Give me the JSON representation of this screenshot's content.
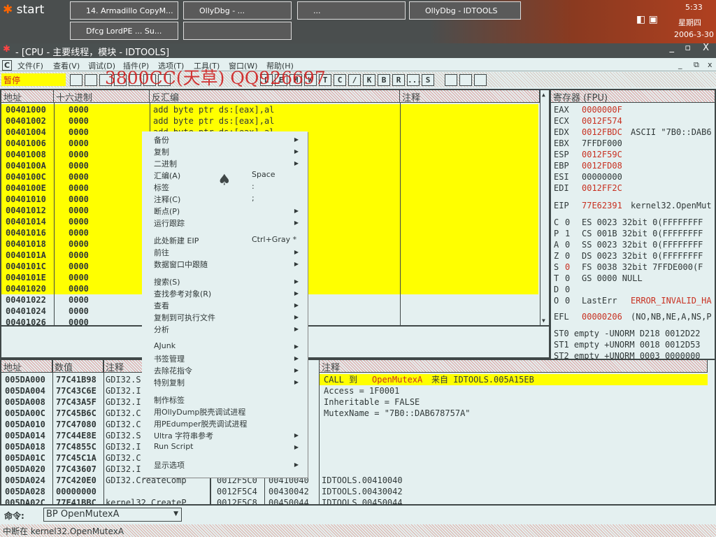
{
  "taskbar": {
    "start": "start",
    "tasks": [
      "14. Armadillo CopyM...",
      "OllyDbg - ...",
      "...",
      "OllyDbg - IDTOOLS",
      "Dfcg LordPE ... Su...",
      ""
    ],
    "time": "5:33",
    "weekday": "星期四",
    "date": "2006-3-30"
  },
  "window": {
    "title": "- [CPU - 主要线程，模块 - IDTOOLS]"
  },
  "menu": [
    "文件(F)",
    "查看(V)",
    "调试(D)",
    "插件(P)",
    "选项(T)",
    "工具(T)",
    "窗口(W)",
    "帮助(H)"
  ],
  "toolbar": {
    "status": "暂停",
    "letters": [
      "L",
      "E",
      "M",
      "W",
      "T",
      "C",
      "/",
      "K",
      "B",
      "R",
      "...",
      "S"
    ],
    "watermark": "3800CC(天草)  QQ926697"
  },
  "disasm": {
    "headers": [
      "地址",
      "十六进制",
      "反汇编",
      "注释"
    ],
    "rows": [
      [
        "00401000",
        "0000",
        "add byte ptr ds:[eax],al"
      ],
      [
        "00401002",
        "0000",
        "add byte ptr ds:[eax],al"
      ],
      [
        "00401004",
        "0000",
        "add byte ptr ds:[eax],al"
      ],
      [
        "00401006",
        "0000",
        ""
      ],
      [
        "00401008",
        "0000",
        ""
      ],
      [
        "0040100A",
        "0000",
        ""
      ],
      [
        "0040100C",
        "0000",
        ""
      ],
      [
        "0040100E",
        "0000",
        ""
      ],
      [
        "00401010",
        "0000",
        ""
      ],
      [
        "00401012",
        "0000",
        ""
      ],
      [
        "00401014",
        "0000",
        ""
      ],
      [
        "00401016",
        "0000",
        ""
      ],
      [
        "00401018",
        "0000",
        ""
      ],
      [
        "0040101A",
        "0000",
        ""
      ],
      [
        "0040101C",
        "0000",
        ""
      ],
      [
        "0040101E",
        "0000",
        ""
      ],
      [
        "00401020",
        "0000",
        ""
      ],
      [
        "00401022",
        "0000",
        ""
      ],
      [
        "00401024",
        "0000",
        ""
      ],
      [
        "00401026",
        "0000",
        ""
      ]
    ],
    "highlighted_count": 17
  },
  "registers": {
    "header": "寄存器 (FPU)",
    "gp": [
      [
        "EAX",
        "0000000F",
        true,
        ""
      ],
      [
        "ECX",
        "0012F574",
        true,
        ""
      ],
      [
        "EDX",
        "0012FBDC",
        true,
        "ASCII \"7B0::DAB6"
      ],
      [
        "EBX",
        "7FFDF000",
        false,
        ""
      ],
      [
        "ESP",
        "0012F59C",
        true,
        ""
      ],
      [
        "EBP",
        "0012FD08",
        true,
        ""
      ],
      [
        "ESI",
        "00000000",
        false,
        ""
      ],
      [
        "EDI",
        "0012FF2C",
        true,
        ""
      ]
    ],
    "eip": [
      "EIP",
      "77E62391",
      "kernel32.OpenMut"
    ],
    "flags": [
      [
        "C",
        "0",
        "ES 0023 32bit 0(FFFFFFFF"
      ],
      [
        "P",
        "1",
        "CS 001B 32bit 0(FFFFFFFF"
      ],
      [
        "A",
        "0",
        "SS 0023 32bit 0(FFFFFFFF"
      ],
      [
        "Z",
        "0",
        "DS 0023 32bit 0(FFFFFFFF"
      ],
      [
        "S",
        "0",
        "FS 0038 32bit 7FFDE000(F"
      ],
      [
        "T",
        "0",
        "GS 0000 NULL"
      ],
      [
        "D",
        "0",
        ""
      ],
      [
        "O",
        "0",
        "LastErr"
      ]
    ],
    "lasterr": "ERROR_INVALID_HA",
    "efl": [
      "EFL",
      "00000206",
      "(NO,NB,NE,A,NS,P"
    ],
    "fpu": [
      "ST0 empty -UNORM D218 0012D22",
      "ST1 empty +UNORM 0018 0012D53",
      "ST2 empty +UNORM 0003 0000000"
    ]
  },
  "dump": {
    "headers": [
      "地址",
      "数值",
      "注释"
    ],
    "rows": [
      [
        "005DA000",
        "77C41B98",
        "GDI32.S"
      ],
      [
        "005DA004",
        "77C43C6E",
        "GDI32.I"
      ],
      [
        "005DA008",
        "77C43A5F",
        "GDI32.I"
      ],
      [
        "005DA00C",
        "77C45B6C",
        "GDI32.C"
      ],
      [
        "005DA010",
        "77C47080",
        "GDI32.C"
      ],
      [
        "005DA014",
        "77C44E8E",
        "GDI32.S"
      ],
      [
        "005DA018",
        "77C4855C",
        "GDI32.I"
      ],
      [
        "005DA01C",
        "77C45C1A",
        "GDI32.C"
      ],
      [
        "005DA020",
        "77C43607",
        "GDI32.I"
      ],
      [
        "005DA024",
        "77C420E0",
        "GDI32.CreateComp"
      ],
      [
        "005DA028",
        "00000000",
        ""
      ],
      [
        "005DA02C",
        "77E41BBC",
        "kernel32.CreateP"
      ]
    ]
  },
  "stack": {
    "header": "注释",
    "call": {
      "prefix": "CALL 到",
      "func": "OpenMutexA",
      "from": "来自 IDTOOLS.005A15EB"
    },
    "args": [
      "Access = 1F0001",
      "Inheritable = FALSE",
      "MutexName = \"7B0::DAB678757A\""
    ],
    "rows": [
      [
        "0012F5C0",
        "00410040",
        "IDTOOLS.00410040"
      ],
      [
        "0012F5C4",
        "00430042",
        "IDTOOLS.00430042"
      ],
      [
        "0012F5C8",
        "00450044",
        "IDTOOLS.00450044"
      ]
    ]
  },
  "context_menu": [
    {
      "label": "备份",
      "sub": true
    },
    {
      "label": "复制",
      "sub": true
    },
    {
      "label": "二进制",
      "sub": true
    },
    {
      "label": "汇编(A)",
      "shortcut": "Space"
    },
    {
      "label": "标签",
      "shortcut": ":"
    },
    {
      "label": "注释(C)",
      "shortcut": ";"
    },
    {
      "label": "断点(P)",
      "sub": true
    },
    {
      "label": "运行跟踪",
      "sub": true
    },
    {
      "sep": true
    },
    {
      "label": "此处新建 EIP",
      "shortcut": "Ctrl+Gray *"
    },
    {
      "label": "前往",
      "sub": true
    },
    {
      "label": "数据窗口中跟随",
      "sub": true
    },
    {
      "sep": true
    },
    {
      "label": "搜索(S)",
      "sub": true
    },
    {
      "label": "查找参考对象(R)",
      "sub": true
    },
    {
      "label": "查看",
      "sub": true
    },
    {
      "label": "复制到可执行文件",
      "sub": true
    },
    {
      "label": "分析",
      "sub": true
    },
    {
      "sep": true
    },
    {
      "label": "AJunk",
      "sub": true
    },
    {
      "label": "书签管理",
      "sub": true
    },
    {
      "label": "去除花指令",
      "sub": true
    },
    {
      "label": "特别复制",
      "sub": true
    },
    {
      "sep": true
    },
    {
      "label": "制作标签"
    },
    {
      "label": "用OllyDump脱壳调试进程"
    },
    {
      "label": "用PEdumper脱壳调试进程"
    },
    {
      "label": "Ultra 字符串参考",
      "sub": true
    },
    {
      "label": "Run Script",
      "sub": true
    },
    {
      "sep": true
    },
    {
      "label": "显示选项",
      "sub": true
    }
  ],
  "command": {
    "label": "命令:",
    "value": "BP OpenMutexA"
  },
  "status": "中断在 kernel32.OpenMutexA"
}
